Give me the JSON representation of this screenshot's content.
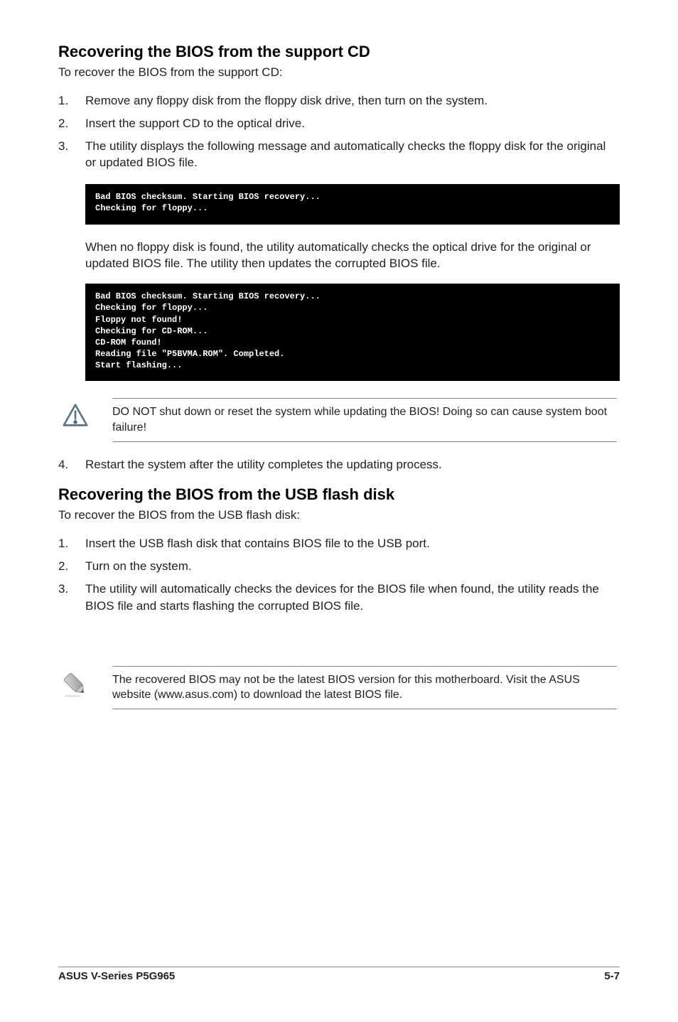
{
  "section1": {
    "heading": "Recovering the BIOS from the support CD",
    "intro": "To recover the BIOS from the support CD:",
    "steps": [
      "Remove any floppy disk from the floppy disk drive, then turn on the system.",
      "Insert the support CD to the optical drive.",
      "The utility displays the following message and automatically checks the floppy disk for the original or updated BIOS file."
    ],
    "terminal1": "Bad BIOS checksum. Starting BIOS recovery...\nChecking for floppy...",
    "after_terminal1": "When no floppy disk is found, the utility automatically checks the optical drive for the original or updated BIOS file. The utility then updates the corrupted BIOS file.",
    "terminal2": "Bad BIOS checksum. Starting BIOS recovery...\nChecking for floppy...\nFloppy not found!\nChecking for CD-ROM...\nCD-ROM found!\nReading file \"P5BVMA.ROM\". Completed.\nStart flashing...",
    "warning": "DO NOT shut down or reset the system while updating the BIOS! Doing so can cause system boot failure!",
    "step4": "Restart the system after the utility completes the updating process."
  },
  "section2": {
    "heading": "Recovering the BIOS from the USB flash disk",
    "intro": "To recover the BIOS from the USB flash disk:",
    "steps": [
      "Insert the USB flash disk that contains BIOS file to the USB port.",
      "Turn on the system.",
      "The utility will automatically checks the devices for the BIOS file when found, the utility reads the BIOS file and starts flashing the corrupted BIOS file."
    ],
    "note": "The recovered BIOS may not be the latest BIOS version for this motherboard. Visit the ASUS website (www.asus.com) to download the latest BIOS file."
  },
  "footer": {
    "left": "ASUS V-Series P5G965",
    "right": "5-7"
  }
}
